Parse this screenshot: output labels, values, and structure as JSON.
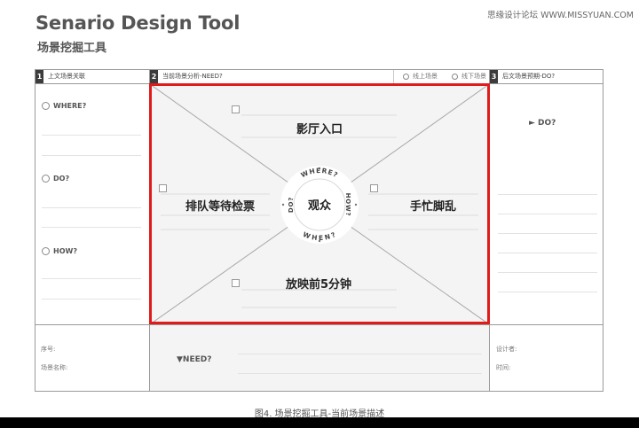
{
  "header": {
    "title": "Senario Design Tool",
    "subtitle": "场景挖掘工具",
    "watermark": "思缘设计论坛 WWW.MISSYUAN.COM"
  },
  "columns": {
    "col1": {
      "num": "1",
      "label": "上文场景关联"
    },
    "col2": {
      "num": "2",
      "label": "当前场景分析-NEED?",
      "option_online": "线上场景",
      "option_offline": "线下场景"
    },
    "col3": {
      "num": "3",
      "label": "后文场景预期-DO?"
    }
  },
  "left_panel": {
    "where": "WHERE?",
    "do": "DO?",
    "how": "HOW?"
  },
  "center": {
    "top": "影厅入口",
    "left": "排队等待检票",
    "right": "手忙脚乱",
    "bottom": "放映前5分钟",
    "hub": "观众",
    "ring_where": "WHERE?",
    "ring_how": "HOW?",
    "ring_when": "WHEN?",
    "ring_do": "DO?"
  },
  "right_panel": {
    "do": "► DO?"
  },
  "footer": {
    "serial": "序号:",
    "scene_name": "场景名称:",
    "need": "▼NEED?",
    "designer": "设计者:",
    "time": "时间:"
  },
  "caption": "图4. 场景挖掘工具-当前场景描述",
  "colors": {
    "highlight": "#e01b1b",
    "panel": "#f4f4f4",
    "border": "#9a9a9a",
    "header_num": "#3c3c3c"
  }
}
